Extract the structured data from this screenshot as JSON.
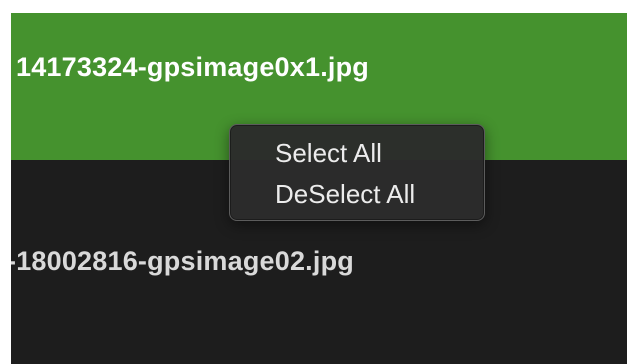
{
  "files": [
    {
      "name": "14173324-gpsimage0x1.jpg",
      "selected": true
    },
    {
      "name": "-18002816-gpsimage02.jpg",
      "selected": false
    }
  ],
  "context_menu": {
    "items": [
      {
        "label": "Select All"
      },
      {
        "label": "DeSelect All"
      }
    ]
  },
  "colors": {
    "selected_row": "#45922e",
    "background": "#1d1d1d",
    "menu_background": "#2b2b2b",
    "menu_text": "#ececec"
  }
}
